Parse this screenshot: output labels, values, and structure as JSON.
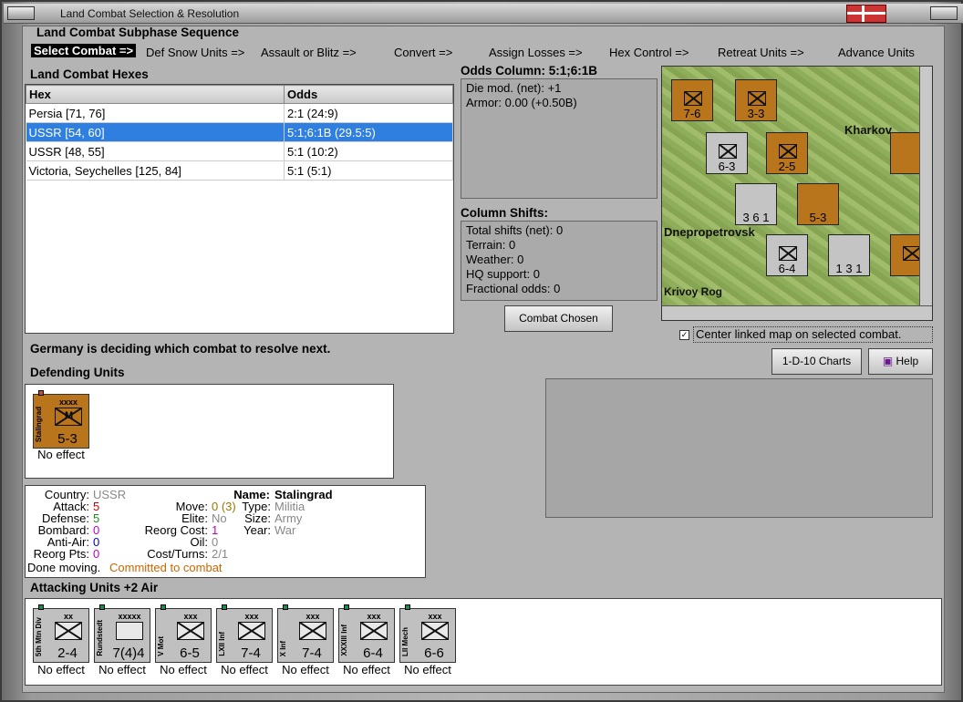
{
  "window": {
    "title": "Land Combat Selection & Resolution"
  },
  "subphase": {
    "heading": "Land Combat Subphase Sequence",
    "steps": [
      "Select Combat =>",
      "Def Snow Units =>",
      "Assault or Blitz =>",
      "Convert =>",
      "Assign Losses =>",
      "Hex Control =>",
      "Retreat Units =>",
      "Advance Units"
    ]
  },
  "hexes": {
    "heading": "Land Combat Hexes",
    "col_hex": "Hex",
    "col_odds": "Odds",
    "rows": [
      {
        "hex": "Persia [71, 76]",
        "odds": "2:1 (24:9)"
      },
      {
        "hex": "USSR [54, 60]",
        "odds": "5:1;6:1B (29.5:5)"
      },
      {
        "hex": "USSR [48, 55]",
        "odds": "5:1 (10:2)"
      },
      {
        "hex": "Victoria, Seychelles [125, 84]",
        "odds": "5:1 (5:1)"
      }
    ]
  },
  "odds": {
    "heading": "Odds Column: 5:1;6:1B",
    "die_mod": "Die mod. (net): +1",
    "armor": "Armor: 0.00 (+0.50B)"
  },
  "shifts": {
    "heading": "Column Shifts:",
    "lines": [
      "Total shifts (net): 0",
      "Terrain: 0",
      "Weather: 0",
      "HQ support: 0",
      "Fractional odds: 0"
    ]
  },
  "buttons": {
    "combat_chosen": "Combat Chosen",
    "charts": "1-D-10 Charts",
    "help": "Help"
  },
  "map": {
    "center_label": "Center linked map on selected combat.",
    "places": [
      "Kharkov",
      "Dnepropetrovsk",
      "Krivoy Rog"
    ]
  },
  "status": "Germany is deciding which combat to resolve next.",
  "defending": {
    "heading": "Defending Units",
    "unit": {
      "name": "Stalingrad",
      "size": "xxxx",
      "value": "5-3",
      "effect": "No effect"
    }
  },
  "details": {
    "country_l": "Country:",
    "country": "USSR",
    "attack_l": "Attack:",
    "attack": "5",
    "defense_l": "Defense:",
    "defense": "5",
    "bombard_l": "Bombard:",
    "bombard": "0",
    "aa_l": "Anti-Air:",
    "aa": "0",
    "reorg_l": "Reorg Pts:",
    "reorg": "0",
    "move_l": "Move:",
    "move": "0 (3)",
    "elite_l": "Elite:",
    "elite": "No",
    "rcost_l": "Reorg Cost:",
    "rcost": "1",
    "oil_l": "Oil:",
    "oil": "0",
    "ct_l": "Cost/Turns:",
    "ct": "2/1",
    "name_l": "Name:",
    "name": "Stalingrad",
    "type_l": "Type:",
    "type": "Militia",
    "size_l": "Size:",
    "size": "Army",
    "year_l": "Year:",
    "year": "War",
    "done": "Done moving.",
    "committed": "Committed to combat"
  },
  "attacking": {
    "heading": "Attacking Units +2 Air",
    "units": [
      {
        "name": "5th Mtn Div",
        "size": "xx",
        "value": "2-4",
        "effect": "No effect"
      },
      {
        "name": "Rundstedt",
        "size": "xxxxx",
        "value": "7(4)4",
        "effect": "No effect"
      },
      {
        "name": "V Mot",
        "size": "xxx",
        "value": "6-5",
        "effect": "No effect"
      },
      {
        "name": "LXII Inf",
        "size": "xxx",
        "value": "7-4",
        "effect": "No effect"
      },
      {
        "name": "X Inf",
        "size": "xxx",
        "value": "7-4",
        "effect": "No effect"
      },
      {
        "name": "XXXIII Inf",
        "size": "xxx",
        "value": "6-4",
        "effect": "No effect"
      },
      {
        "name": "LII Mech",
        "size": "xxx",
        "value": "6-6",
        "effect": "No effect"
      }
    ]
  },
  "colors": {
    "selection": "#2f7fe0",
    "soviet": "#b8751c",
    "attack": "#cc0000",
    "defense": "#1a8a1a",
    "bombard": "#c000c0",
    "aa": "#0000cc",
    "committed": "#cc6600"
  }
}
